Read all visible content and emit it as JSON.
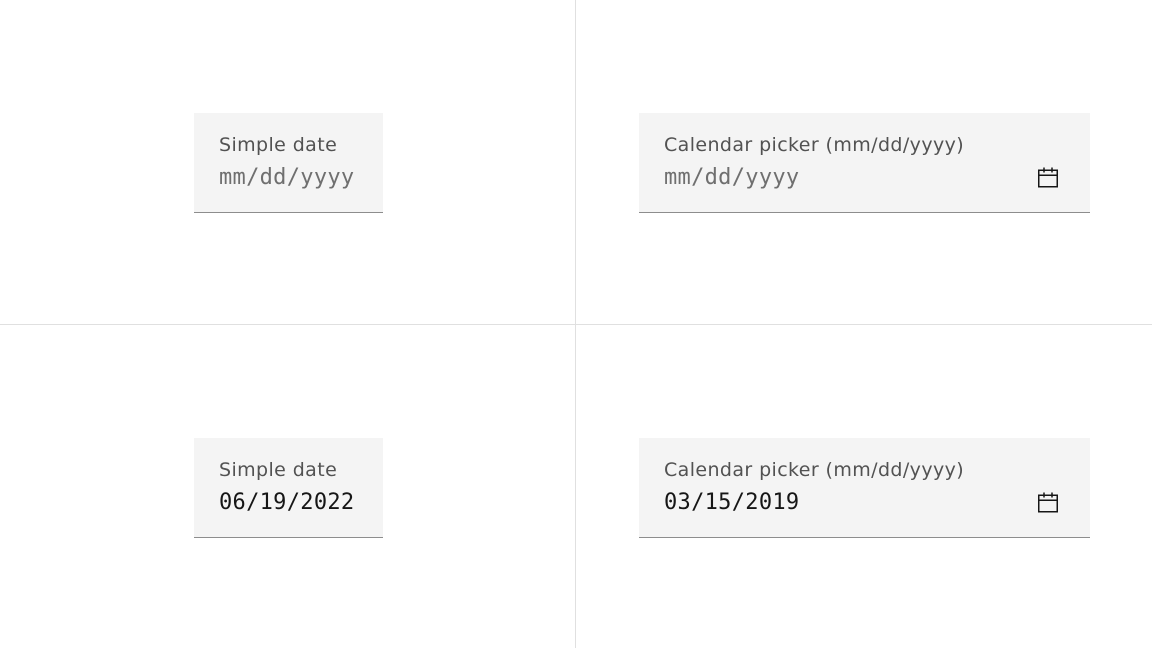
{
  "fields": [
    {
      "label": "Simple date",
      "placeholder": "mm/dd/yyyy",
      "value": "",
      "type": "simple"
    },
    {
      "label": "Calendar picker (mm/dd/yyyy)",
      "placeholder": "mm/dd/yyyy",
      "value": "",
      "type": "calendar",
      "icon": "calendar-icon"
    },
    {
      "label": "Simple date",
      "placeholder": "mm/dd/yyyy",
      "value": "06/19/2022",
      "type": "simple"
    },
    {
      "label": "Calendar picker (mm/dd/yyyy)",
      "placeholder": "mm/dd/yyyy",
      "value": "03/15/2019",
      "type": "calendar",
      "icon": "calendar-icon"
    }
  ],
  "colors": {
    "field_background": "#f4f4f4",
    "field_border": "#8d8d8d",
    "label": "#525252",
    "placeholder": "#6f6f6f",
    "value_text": "#161616",
    "divider": "#e0e0e0"
  }
}
